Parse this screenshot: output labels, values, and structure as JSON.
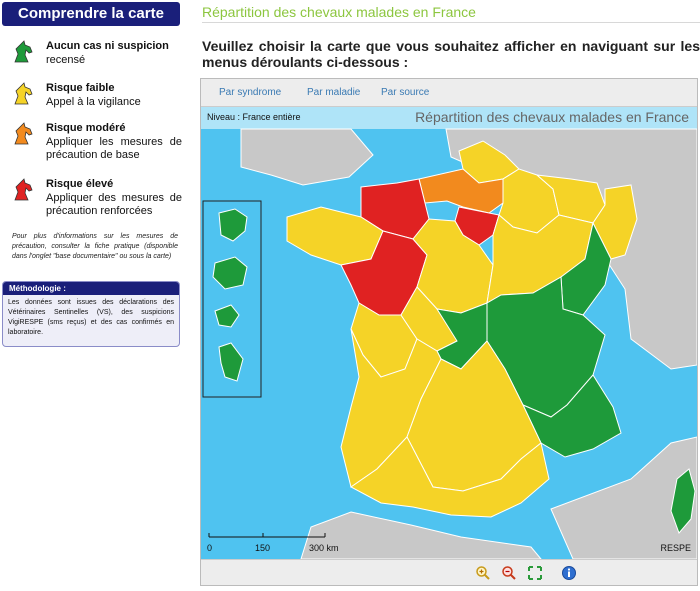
{
  "sidebar": {
    "title": "Comprendre la carte",
    "legend": [
      {
        "title": "Aucun cas ni suspicion",
        "desc": "recensé",
        "color": "#1e9a3a",
        "icon": "green-horse-icon"
      },
      {
        "title": "Risque faible",
        "desc": "Appel à la vigilance",
        "color": "#f5d327",
        "icon": "yellow-horse-icon"
      },
      {
        "title": "Risque modéré",
        "desc": "Appliquer les mesures de précaution de base",
        "color": "#f28a1e",
        "icon": "orange-horse-icon"
      },
      {
        "title": "Risque élevé",
        "desc": "Appliquer des mesures de précaution renforcées",
        "color": "#e02222",
        "icon": "red-horse-icon"
      }
    ],
    "note": "Pour plus d'informations sur les mesures de précaution, consulter la fiche pratique (disponible dans l'onglet \"base documentaire\" ou sous la carte)",
    "methodo": {
      "title": "Méthodologie :",
      "text": "Les données sont issues des déclarations des Vétérinaires Sentinelles (VS), des suspicions VigiRESPE (sms reçus) et des cas confirmés en laboratoire."
    }
  },
  "main": {
    "title": "Répartition des chevaux malades en France",
    "intro": "Veuillez choisir la carte que vous souhaitez afficher en naviguant sur les menus déroulants ci-dessous :",
    "tabs": [
      "Par syndrome",
      "Par maladie",
      "Par source"
    ],
    "map": {
      "niveau": "Niveau : France entière",
      "title": "Répartition des chevaux malades en France",
      "scale": [
        "0",
        "150",
        "300 km"
      ],
      "credit": "RESPE",
      "colors": {
        "sea": "#4fc3f0",
        "land": "#c8c8c8",
        "green": "#1e9a3a",
        "yellow": "#f5d327",
        "orange": "#f28a1e",
        "red": "#e02222"
      }
    },
    "toolbar": [
      "zoom-in-icon",
      "zoom-out-icon",
      "full-extent-icon",
      "info-icon"
    ]
  }
}
